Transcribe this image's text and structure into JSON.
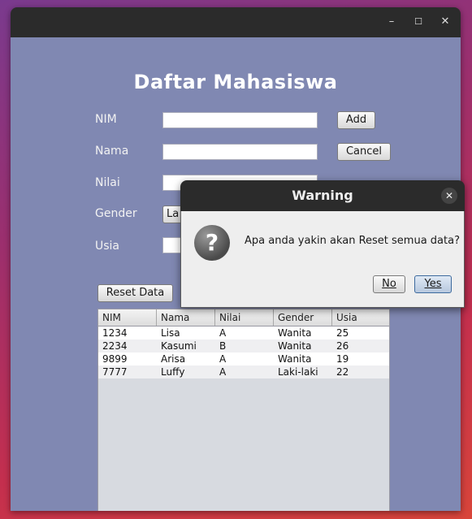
{
  "window": {
    "title_icons": {
      "minimize": "minimize-icon",
      "maximize": "maximize-icon",
      "close": "close-icon"
    },
    "heading": "Daftar Mahasiswa"
  },
  "form": {
    "labels": {
      "nim": "NIM",
      "nama": "Nama",
      "nilai": "Nilai",
      "gender": "Gender",
      "usia": "Usia"
    },
    "values": {
      "nim": "",
      "nama": "",
      "nilai": "",
      "usia": ""
    },
    "gender_selected": "La",
    "add_label": "Add",
    "cancel_label": "Cancel",
    "reset_label": "Reset Data"
  },
  "table": {
    "columns": [
      "NIM",
      "Nama",
      "Nilai",
      "Gender",
      "Usia"
    ],
    "rows": [
      [
        "1234",
        "Lisa",
        "A",
        "Wanita",
        "25"
      ],
      [
        "2234",
        "Kasumi",
        "B",
        "Wanita",
        "26"
      ],
      [
        "9899",
        "Arisa",
        "A",
        "Wanita",
        "19"
      ],
      [
        "7777",
        "Luffy",
        "A",
        "Laki-laki",
        "22"
      ]
    ]
  },
  "dialog": {
    "title": "Warning",
    "message": "Apa anda yakin akan Reset semua data?",
    "icon": "question-icon",
    "no_label": "No",
    "yes_label": "Yes"
  },
  "colors": {
    "content_bg": "#8088b2",
    "titlebar": "#2b2b2b",
    "dialog_bg": "#eeeeee"
  }
}
